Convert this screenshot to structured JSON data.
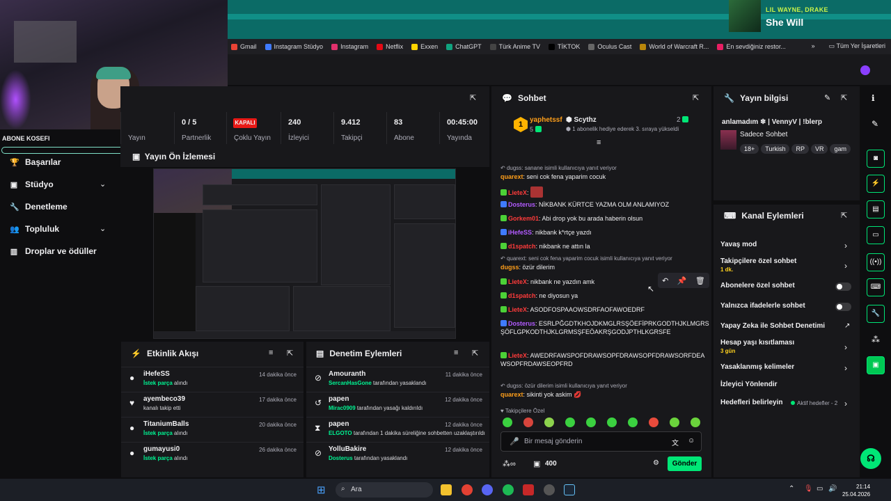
{
  "music": {
    "artist": "LIL WAYNE, DRAKE",
    "title": "She Will"
  },
  "bookmarks": {
    "items": [
      {
        "label": "Gmail",
        "color": "#ea4335"
      },
      {
        "label": "Instagram Stüdyo",
        "color": "#3f7bff"
      },
      {
        "label": "Instagram",
        "color": "#e1306c"
      },
      {
        "label": "Netflix",
        "color": "#e50914"
      },
      {
        "label": "Exxen",
        "color": "#ffd400"
      },
      {
        "label": "ChatGPT",
        "color": "#10a37f"
      },
      {
        "label": "Türk Anime TV",
        "color": "#444444"
      },
      {
        "label": "TİKTOK",
        "color": "#000000"
      },
      {
        "label": "Oculus Cast",
        "color": "#666666"
      },
      {
        "label": "World of Warcraft R...",
        "color": "#b8860b"
      },
      {
        "label": "En sevdiğiniz restor...",
        "color": "#e91e63"
      }
    ],
    "more": "»",
    "all": "Tüm Yer İşaretleri"
  },
  "sidebar": {
    "label": "ABONE KOSEFI",
    "items": [
      {
        "label": "Başarılar",
        "icon": "trophy-icon",
        "glyph": "🏆"
      },
      {
        "label": "Stüdyo",
        "icon": "film-icon",
        "glyph": "▣",
        "chevron": true
      },
      {
        "label": "Denetleme",
        "icon": "wrench-icon",
        "glyph": "🔧"
      },
      {
        "label": "Topluluk",
        "icon": "people-icon",
        "glyph": "👥",
        "chevron": true
      },
      {
        "label": "Droplar ve ödüller",
        "icon": "chart-icon",
        "glyph": "▥"
      }
    ]
  },
  "stats": {
    "tiles": [
      {
        "label": "Yayın",
        "value": ""
      },
      {
        "label": "Partnerlik",
        "value": "0 / 5"
      },
      {
        "label": "Çoklu Yayın",
        "value": ""
      },
      {
        "label": "İzleyici",
        "value": "240"
      },
      {
        "label": "Takipçi",
        "value": "9.412"
      },
      {
        "label": "Abone",
        "value": "83"
      },
      {
        "label": "Yayında",
        "value": "00:45:00"
      }
    ],
    "offline_label": "KAPALI"
  },
  "preview": {
    "title": "Yayın Ön İzlemesi"
  },
  "activity": {
    "title": "Etkinlik Akışı",
    "rows": [
      {
        "name": "iHefeSS",
        "highlight": "İstek parça",
        "rest": " alındı",
        "time": "14 dakika önce",
        "glyph": "●"
      },
      {
        "name": "ayembeco39",
        "highlight": "",
        "rest": "kanalı takip etti",
        "time": "17 dakika önce",
        "glyph": "♥"
      },
      {
        "name": "TitaniumBalls",
        "highlight": "İstek parça",
        "rest": " alındı",
        "time": "20 dakika önce",
        "glyph": "●"
      },
      {
        "name": "gumayusi0",
        "highlight": "İstek parça",
        "rest": " alındı",
        "time": "26 dakika önce",
        "glyph": "●"
      }
    ]
  },
  "moderation": {
    "title": "Denetim Eylemleri",
    "rows": [
      {
        "name": "Amouranth",
        "highlight": "SercanHasGone",
        "rest": " tarafından yasaklandı",
        "time": "11 dakika önce",
        "glyph": "⊘"
      },
      {
        "name": "papen",
        "highlight": "Mirac0909",
        "rest": " tarafından yasağı kaldırıldı",
        "time": "12 dakika önce",
        "glyph": "↺"
      },
      {
        "name": "papen",
        "highlight": "ELGOTO",
        "rest": " tarafından 1 dakika süreliğine sohbetten uzaklaştırıldı",
        "time": "12 dakika önce",
        "glyph": "⧗"
      },
      {
        "name": "YolluBakire",
        "highlight": "Dosterus",
        "rest": " tarafından yasaklandı",
        "time": "12 dakika önce",
        "glyph": "⊘"
      }
    ]
  },
  "chat": {
    "title": "Sohbet",
    "pinned": {
      "user": "yaphetssf",
      "count": "5",
      "rank": "1",
      "gifter": "Scythz",
      "gifter_count": "2",
      "text": "1 abonelik hediye ederek 3. sıraya yükseldi"
    },
    "messages": [
      {
        "reply": "dugss: sanane isimli kullanıcıya yanıt veriyor",
        "user": "quarext",
        "ucls": "u-orange",
        "text": "seni cok fena yaparim cocuk"
      },
      {
        "user": "LieteX",
        "ucls": "u-red",
        "text": ""
      },
      {
        "user": "Dosterus",
        "ucls": "u-purple",
        "text": "NİKBANK KÜRTCE YAZMA OLM ANLAMIYOZ"
      },
      {
        "user": "Gorkem01",
        "ucls": "u-red",
        "text": "Abi drop yok bu arada haberin olsun"
      },
      {
        "user": "iHefeSS",
        "ucls": "u-purple",
        "text": "nikbank k*rtçe yazdı"
      },
      {
        "user": "d1spatch",
        "ucls": "u-red",
        "text": "nikbank ne attın la"
      },
      {
        "reply": "quarext: seni cok fena yaparim cocuk isimli kullanıcıya yanıt veriyor",
        "user": "dugss",
        "ucls": "u-orange",
        "text": "özür dilerim"
      },
      {
        "user": "LieteX",
        "ucls": "u-red",
        "text": "nikbank ne yazdın amk"
      },
      {
        "user": "d1spatch",
        "ucls": "u-red",
        "text": "ne diyosun ya"
      },
      {
        "user": "LieteX",
        "ucls": "u-red",
        "text": "ASODFOSPAAOWSDRFAOFAWOEDRF"
      },
      {
        "user": "Dosterus",
        "ucls": "u-purple",
        "text": "ESRLPĞGDTKHOJDKMGLRSŞÖEFİPRKGODTHJKLMGRSŞÖFLGPKODTHJKLGRMSŞFEÖAKRŞGODJPTHLKGRSFE"
      },
      {
        "user": "LieteX",
        "ucls": "u-red",
        "text": "AWEDRFAWSPOFDRAWSOPFDRAWSOPFDRAWSORFDEAWSOPFRDAWSEOPFRD"
      },
      {
        "reply": "dugss: özür dilerim isimli kullanıcıya yanıt veriyor",
        "user": "quarext",
        "ucls": "u-orange",
        "text": "sikinti yok askim 💋"
      }
    ],
    "followers_only": "Takipçilere Özel",
    "input_placeholder": "Bir mesaj gönderin",
    "points": "400",
    "send_label": "Gönder"
  },
  "stream_info": {
    "title": "Yayın bilgisi",
    "stream_title": "anlamadım  ❄  | VennyV | !blerp",
    "category": "Sadece Sohbet",
    "tags": [
      "18+",
      "Turkish",
      "RP",
      "VR",
      "gam"
    ]
  },
  "channel_actions": {
    "title": "Kanal Eylemleri",
    "items": [
      {
        "label": "Yavaş mod",
        "sub": "",
        "control": "arrow"
      },
      {
        "label": "Takipçilere özel sohbet",
        "sub": "1 dk.",
        "control": "arrow"
      },
      {
        "label": "Abonelere özel sohbet",
        "sub": "",
        "control": "toggle"
      },
      {
        "label": "Yalnızca ifadelerle sohbet",
        "sub": "",
        "control": "toggle"
      },
      {
        "label": "Yapay Zeka ile Sohbet Denetimi",
        "sub": "",
        "control": "external"
      },
      {
        "label": "Hesap yaşı kısıtlaması",
        "sub": "3 gün",
        "control": "arrow"
      },
      {
        "label": "Yasaklanmış kelimeler",
        "sub": "",
        "control": "arrow"
      },
      {
        "label": "İzleyici Yönlendir",
        "sub": "",
        "control": "none"
      },
      {
        "label": "Hedefleri belirleyin",
        "sub": "",
        "control": "arrow",
        "extra": "Aktif hedefler - 2"
      }
    ]
  },
  "taskbar": {
    "search_placeholder": "Ara",
    "time": "21:14",
    "date": "25.04.2026"
  }
}
